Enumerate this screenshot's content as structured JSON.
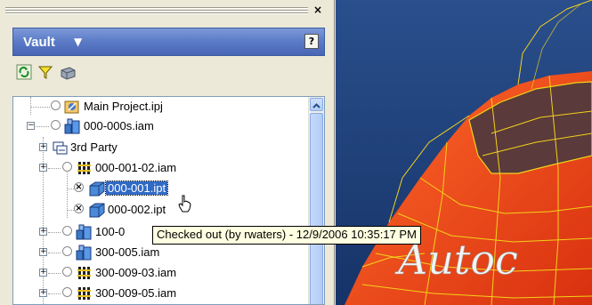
{
  "panel": {
    "title": "Vault",
    "help_label": "?",
    "close_label": "×"
  },
  "toolbar": {
    "icons": [
      "refresh-icon",
      "filter-icon",
      "server-icon"
    ]
  },
  "tree": {
    "items": [
      {
        "label": "Main Project.ipj",
        "icon": "project-icon",
        "status": "none"
      },
      {
        "label": "000-000s.iam",
        "icon": "assembly-icon",
        "status": "none"
      },
      {
        "label": "3rd Party",
        "icon": "folder-icon",
        "status": "none"
      },
      {
        "label": "000-001-02.iam",
        "icon": "assembly-grid-icon",
        "status": "none"
      },
      {
        "label": "000-001.ipt",
        "icon": "part-icon",
        "status": "checked-out",
        "selected": true
      },
      {
        "label": "000-002.ipt",
        "icon": "part-icon",
        "status": "checked-out"
      },
      {
        "label": "100-0",
        "icon": "assembly-icon",
        "status": "none"
      },
      {
        "label": "300-005.iam",
        "icon": "assembly-icon",
        "status": "none"
      },
      {
        "label": "300-009-03.iam",
        "icon": "assembly-grid-icon",
        "status": "none"
      },
      {
        "label": "300-009-05.iam",
        "icon": "assembly-grid-icon",
        "status": "none"
      }
    ]
  },
  "tooltip": {
    "text": "Checked out (by rwaters) - 12/9/2006 10:35:17 PM"
  },
  "viewport": {
    "brand_text": "Autoc",
    "colors": {
      "background": "#1c3f7a",
      "car": "#e8431a",
      "wire": "#f2d21a"
    }
  }
}
